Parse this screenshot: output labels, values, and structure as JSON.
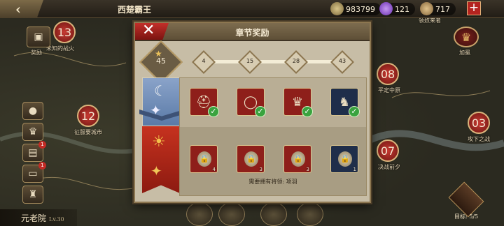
{
  "topbar": {
    "title": "西楚霸王",
    "back_icon": "back-arrow-icon",
    "resources": [
      {
        "name": "gold",
        "value": "983799",
        "icon": "coin-icon",
        "color": "#9a8a5a"
      },
      {
        "name": "gem",
        "value": "121",
        "icon": "gem-icon",
        "color": "#8a4fc9"
      },
      {
        "name": "troops",
        "value": "717",
        "icon": "scroll-icon",
        "color": "#a8884e"
      }
    ],
    "add_label": "+"
  },
  "map": {
    "markers": [
      {
        "num": "13",
        "label": "未知的战火"
      },
      {
        "num": "12",
        "label": "征服要城市"
      },
      {
        "num": "08",
        "label": "平定中原"
      },
      {
        "num": "07",
        "label": "决战前夕"
      },
      {
        "num": "03",
        "label": "攻下之战"
      }
    ],
    "chest_label": "奖励",
    "crown_label": "加冕",
    "rank_label": "领奴来者",
    "treasure_label": "目标: 5/5"
  },
  "sidebar": {
    "items": [
      {
        "icon": "bag-icon",
        "badge": ""
      },
      {
        "icon": "crown-icon",
        "badge": ""
      },
      {
        "icon": "film-icon",
        "badge": "1"
      },
      {
        "icon": "chest-icon",
        "badge": "1"
      },
      {
        "icon": "trophy-icon",
        "badge": ""
      }
    ],
    "senate": "元老院",
    "senate_level": "Lv.30"
  },
  "dialog": {
    "title": "章节奖励",
    "close_label": "✕",
    "stars": "45",
    "milestones": [
      "4",
      "15",
      "28",
      "43"
    ],
    "rows": [
      {
        "banner": "moon",
        "rewards": [
          {
            "icon": "helmet-icon",
            "claimed": true
          },
          {
            "icon": "bracelet-icon",
            "claimed": true
          },
          {
            "icon": "crown-icon",
            "claimed": true
          },
          {
            "icon": "armor-icon",
            "claimed": true
          }
        ]
      },
      {
        "banner": "sun",
        "rewards": [
          {
            "icon": "helmet-icon",
            "count": "4",
            "locked": true
          },
          {
            "icon": "bracelet-icon",
            "count": "3",
            "locked": true
          },
          {
            "icon": "bracelet-icon",
            "count": "3",
            "locked": true
          },
          {
            "icon": "spear-icon",
            "count": "1",
            "locked": true
          }
        ]
      }
    ],
    "requirement": "需要拥有将领: 项羽"
  }
}
